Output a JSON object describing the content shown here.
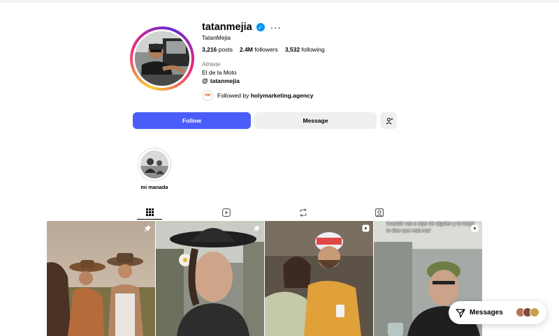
{
  "profile": {
    "username": "tatanmejia",
    "full_name": "TatanMejia",
    "category": "Athlete",
    "bio": "El de la Moto",
    "threads_handle": "tatanmejia",
    "followed_by_prefix": "Followed by ",
    "followed_by_account": "holymarketing.agency",
    "followed_by_avatar_text": "HM"
  },
  "stats": {
    "posts_count": "3,216",
    "posts_label": "posts",
    "followers_count": "2.4M",
    "followers_label": "followers",
    "following_count": "3,532",
    "following_label": "following"
  },
  "actions": {
    "follow_label": "Follow",
    "message_label": "Message"
  },
  "highlights": [
    {
      "label": "mi manada"
    }
  ],
  "tabs": [
    {
      "name": "posts",
      "icon": "grid-icon",
      "active": true
    },
    {
      "name": "reels",
      "icon": "reels-icon",
      "active": false
    },
    {
      "name": "reposts",
      "icon": "repost-icon",
      "active": false
    },
    {
      "name": "tagged",
      "icon": "tagged-icon",
      "active": false
    }
  ],
  "posts": [
    {
      "type": "photo",
      "pinned": true,
      "caption": ""
    },
    {
      "type": "photo",
      "pinned": true,
      "caption": ""
    },
    {
      "type": "reel",
      "pinned": false,
      "caption": ""
    },
    {
      "type": "reel",
      "pinned": false,
      "caption": "Cuando vas a rajar de alguien y tu mujer te dice que está mal"
    }
  ],
  "messages": {
    "label": "Messages"
  },
  "colors": {
    "follow_button": "#4a5df9",
    "verified_badge": "#0095f6",
    "secondary_button": "#efefef",
    "muted_text": "#737373"
  }
}
